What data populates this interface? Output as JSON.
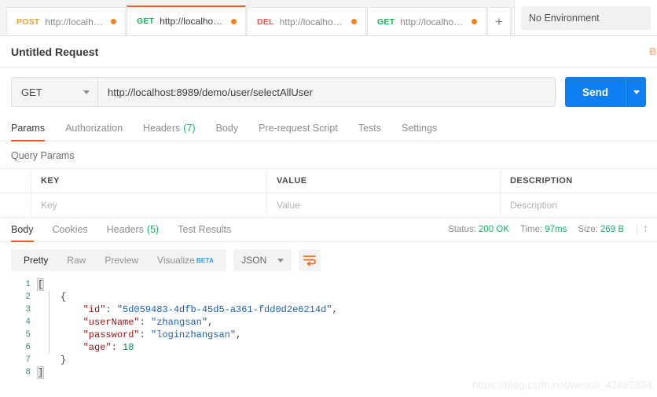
{
  "tabstrip": {
    "tabs": [
      {
        "method": "POST",
        "method_class": "m-post",
        "url": "http://localhos...",
        "active": false
      },
      {
        "method": "GET",
        "method_class": "m-get",
        "url": "http://localhost...",
        "active": true
      },
      {
        "method": "DEL",
        "method_class": "m-del",
        "url": "http://localhost...",
        "active": false
      },
      {
        "method": "GET",
        "method_class": "m-get",
        "url": "http://localhost...",
        "active": false
      }
    ],
    "new_tab_label": "+",
    "more_label": "•••",
    "environment": "No Environment"
  },
  "request": {
    "title": "Untitled Request",
    "method": "GET",
    "url": "http://localhost:8989/demo/user/selectAllUser",
    "send_label": "Send",
    "beta_cut": "B",
    "tabs": [
      {
        "label": "Params",
        "count": "",
        "active": true
      },
      {
        "label": "Authorization",
        "count": "",
        "active": false
      },
      {
        "label": "Headers",
        "count": "(7)",
        "active": false
      },
      {
        "label": "Body",
        "count": "",
        "active": false
      },
      {
        "label": "Pre-request Script",
        "count": "",
        "active": false
      },
      {
        "label": "Tests",
        "count": "",
        "active": false
      },
      {
        "label": "Settings",
        "count": "",
        "active": false
      }
    ]
  },
  "query_params": {
    "section_label": "Query Params",
    "columns": [
      "KEY",
      "VALUE",
      "DESCRIPTION"
    ],
    "placeholder_row": [
      "Key",
      "Value",
      "Description"
    ]
  },
  "response": {
    "tabs": [
      {
        "label": "Body",
        "count": "",
        "active": true
      },
      {
        "label": "Cookies",
        "count": "",
        "active": false
      },
      {
        "label": "Headers",
        "count": "(5)",
        "active": false
      },
      {
        "label": "Test Results",
        "count": "",
        "active": false
      }
    ],
    "status_label": "Status:",
    "status_value": "200 OK",
    "time_label": "Time:",
    "time_value": "97ms",
    "size_label": "Size:",
    "size_value": "269 B",
    "save_response_cut": "Save Response",
    "view_modes": [
      {
        "label": "Pretty",
        "active": true
      },
      {
        "label": "Raw",
        "active": false
      },
      {
        "label": "Preview",
        "active": false
      },
      {
        "label": "Visualize",
        "active": false,
        "badge": "BETA"
      }
    ],
    "format": "JSON",
    "wrap_icon": "wrap-lines-icon",
    "body_lines": [
      {
        "n": "1",
        "type": "bracket-open"
      },
      {
        "n": "2",
        "type": "brace-open"
      },
      {
        "n": "3",
        "type": "kv-str",
        "key": "\"id\"",
        "value": "\"5d059483-4dfb-45d5-a361-fdd0d2e6214d\"",
        "comma": ","
      },
      {
        "n": "4",
        "type": "kv-str",
        "key": "\"userName\"",
        "value": "\"zhangsan\"",
        "comma": ","
      },
      {
        "n": "5",
        "type": "kv-str",
        "key": "\"password\"",
        "value": "\"loginzhangsan\"",
        "comma": ","
      },
      {
        "n": "6",
        "type": "kv-num",
        "key": "\"age\"",
        "value": "18",
        "comma": ""
      },
      {
        "n": "7",
        "type": "brace-close"
      },
      {
        "n": "8",
        "type": "bracket-close"
      }
    ]
  },
  "watermark": "https://blog.csdn.net/weixin_42862834",
  "colors": {
    "accent_orange": "#ef5b25",
    "send_blue": "#0d7ff2",
    "status_green": "#17b26a",
    "beta_blue": "#2d9cdb"
  }
}
